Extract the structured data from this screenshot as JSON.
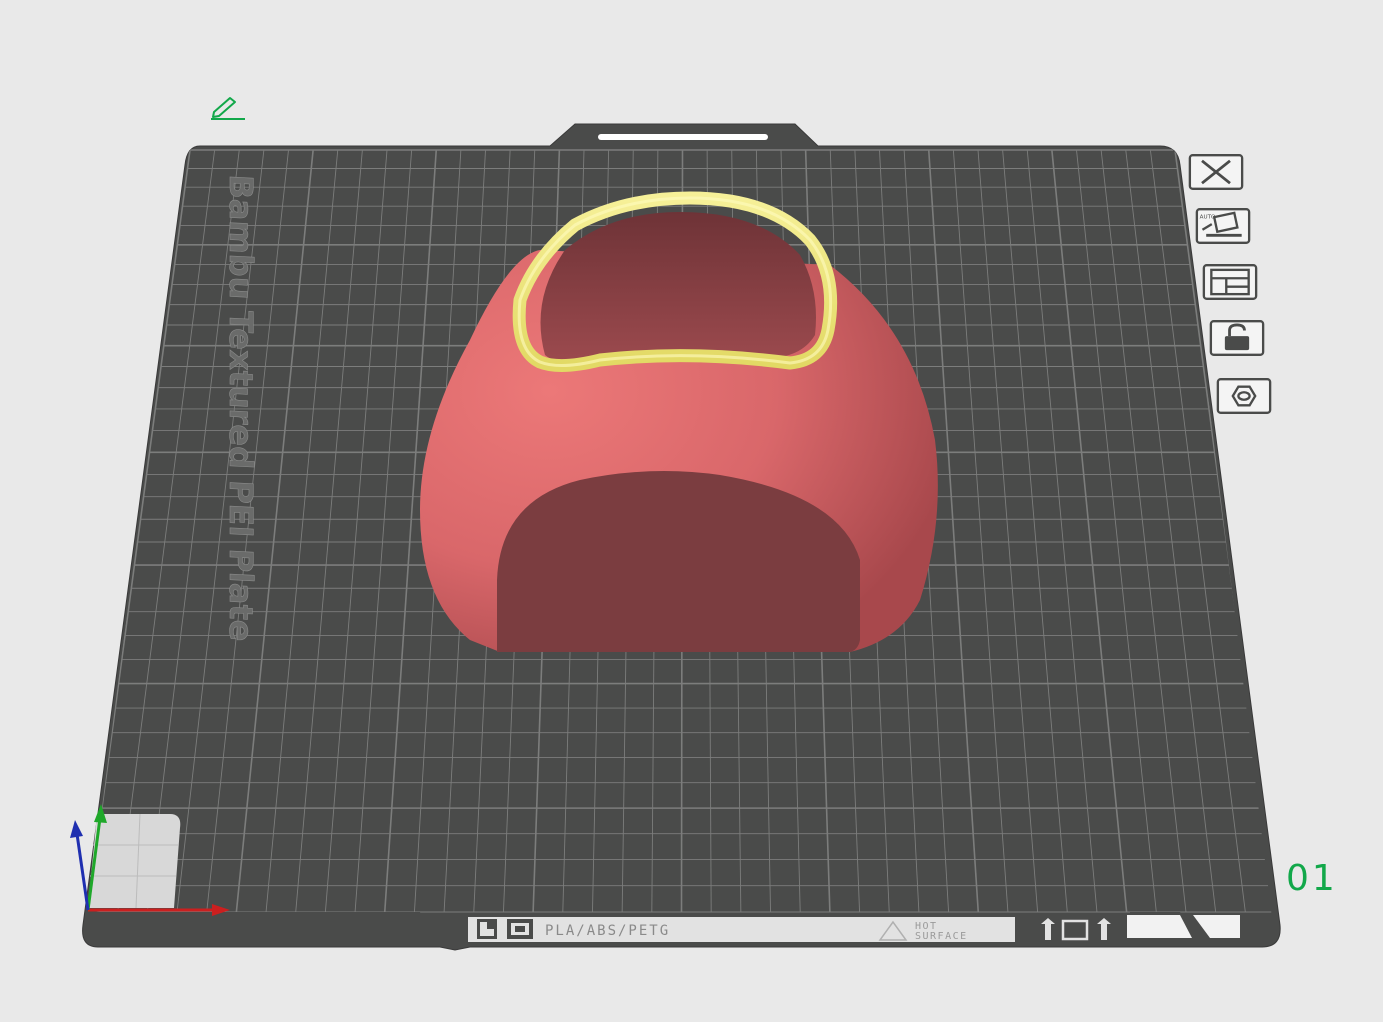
{
  "plate": {
    "name": "Bambu Textured PEI Plate",
    "number": "01",
    "material_label": "PLA/ABS/PETG",
    "hot_surface_label": "HOT\nSURFACE",
    "hot_label_line1": "HOT",
    "hot_label_line2": "SURFACE"
  },
  "colors": {
    "background": "#e9e9e9",
    "plate_surface": "#4a4b4a",
    "grid_line": "#7c7d7c",
    "model_body": "#d9676a",
    "model_rim": "#f2ec84",
    "accent_green": "#12a84a"
  },
  "toolbar": {
    "items": [
      {
        "icon": "close-icon",
        "label": "Remove plate"
      },
      {
        "icon": "auto-orient-icon",
        "label": "Auto orient",
        "text": "AUTO"
      },
      {
        "icon": "arrange-icon",
        "label": "Arrange"
      },
      {
        "icon": "lock-icon",
        "label": "Lock plate"
      },
      {
        "icon": "settings-icon",
        "label": "Plate settings"
      }
    ]
  },
  "axes": {
    "x_color": "#cc1f1f",
    "y_color": "#1fa82a",
    "z_color": "#1f2fb0"
  }
}
